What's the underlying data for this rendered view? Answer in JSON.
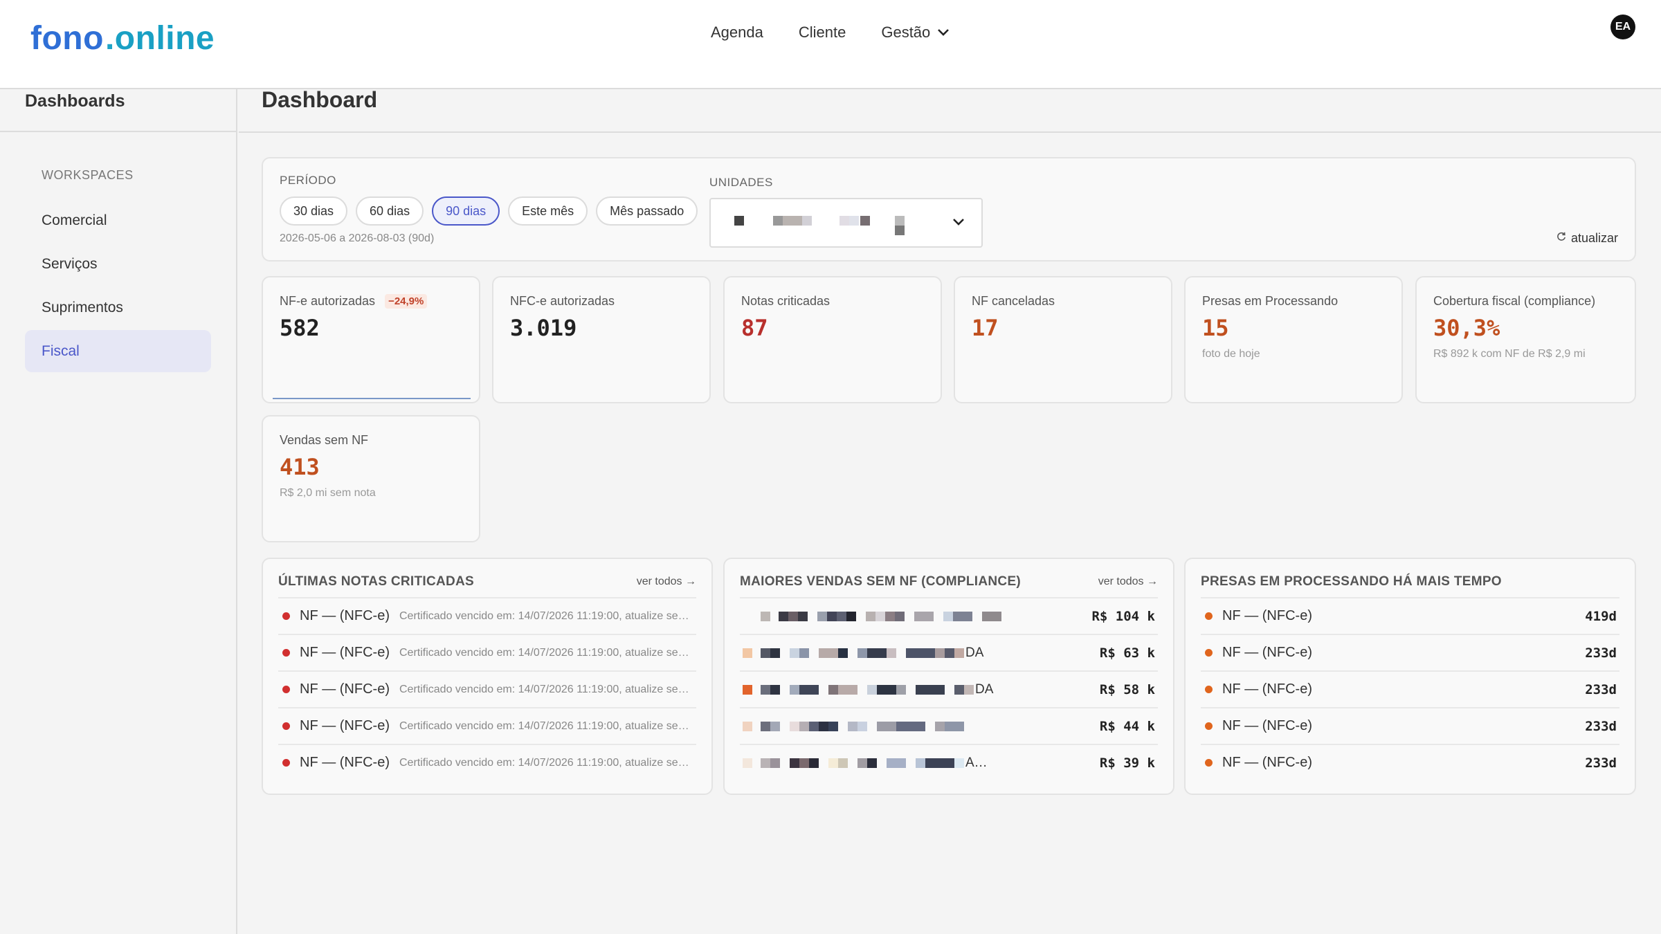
{
  "app": {
    "logo_main": "fono",
    "logo_dot": ".",
    "logo_tail": "online",
    "user_initials": "EA"
  },
  "nav": {
    "items": [
      "Agenda",
      "Cliente"
    ],
    "gestao": "Gestão"
  },
  "sidebar": {
    "title": "Dashboards",
    "section": "WORKSPACES",
    "items": [
      {
        "label": "Comercial",
        "active": false
      },
      {
        "label": "Serviços",
        "active": false
      },
      {
        "label": "Suprimentos",
        "active": false
      },
      {
        "label": "Fiscal",
        "active": true
      }
    ]
  },
  "page": {
    "title": "Dashboard"
  },
  "filters": {
    "period_label": "PERÍODO",
    "periods": [
      "30 dias",
      "60 dias",
      "90 dias",
      "Este mês",
      "Mês passado"
    ],
    "active_period": "90 dias",
    "range": "2026-05-06 a 2026-08-03 (90d)",
    "units_label": "UNIDADES",
    "refresh": "atualizar"
  },
  "kpis": [
    {
      "label": "NF-e autorizadas",
      "delta": "−24,9%",
      "value": "582",
      "sub": ""
    },
    {
      "label": "NFC-e autorizadas",
      "value": "3.019",
      "sub": ""
    },
    {
      "label": "Notas criticadas",
      "value": "87",
      "sub": ""
    },
    {
      "label": "NF canceladas",
      "value": "17",
      "sub": ""
    },
    {
      "label": "Presas em Processando",
      "value": "15",
      "sub": "foto de hoje"
    },
    {
      "label": "Cobertura fiscal (compliance)",
      "value": "30,3%",
      "sub": "R$ 892 k com NF de R$ 2,9 mi"
    },
    {
      "label": "Vendas sem NF",
      "value": "413",
      "sub": "R$ 2,0 mi sem nota"
    }
  ],
  "panels": {
    "criticadas": {
      "title": "ÚLTIMAS NOTAS CRITICADAS",
      "link": "ver todos →",
      "rows": [
        {
          "title": "NF — (NFC-e)",
          "detail": "Certificado vencido em: 14/07/2026 11:19:00, atualize seu certificado"
        },
        {
          "title": "NF — (NFC-e)",
          "detail": "Certificado vencido em: 14/07/2026 11:19:00, atualize seu certificado"
        },
        {
          "title": "NF — (NFC-e)",
          "detail": "Certificado vencido em: 14/07/2026 11:19:00, atualize seu certificado"
        },
        {
          "title": "NF — (NFC-e)",
          "detail": "Certificado vencido em: 14/07/2026 11:19:00, atualize seu certificado"
        },
        {
          "title": "NF — (NFC-e)",
          "detail": "Certificado vencido em: 14/07/2026 11:19:00, atualize seu certificado"
        }
      ]
    },
    "vendas": {
      "title": "MAIORES VENDAS SEM NF (COMPLIANCE)",
      "link": "ver todos →",
      "rows": [
        {
          "suffix": "",
          "value": "R$ 104 k"
        },
        {
          "suffix": "DA",
          "value": "R$ 63 k"
        },
        {
          "suffix": "DA",
          "value": "R$ 58 k"
        },
        {
          "suffix": "",
          "value": "R$ 44 k"
        },
        {
          "suffix": "A…",
          "value": "R$ 39 k"
        }
      ]
    },
    "presas": {
      "title": "PRESAS EM PROCESSANDO HÁ MAIS TEMPO",
      "rows": [
        {
          "title": "NF — (NFC-e)",
          "value": "419d"
        },
        {
          "title": "NF — (NFC-e)",
          "value": "233d"
        },
        {
          "title": "NF — (NFC-e)",
          "value": "233d"
        },
        {
          "title": "NF — (NFC-e)",
          "value": "233d"
        },
        {
          "title": "NF — (NFC-e)",
          "value": "233d"
        }
      ]
    }
  },
  "colors": {
    "accent": "#4a57c9",
    "danger": "#b8302d",
    "warning": "#c0501f",
    "logo": "#2f6fd6"
  }
}
